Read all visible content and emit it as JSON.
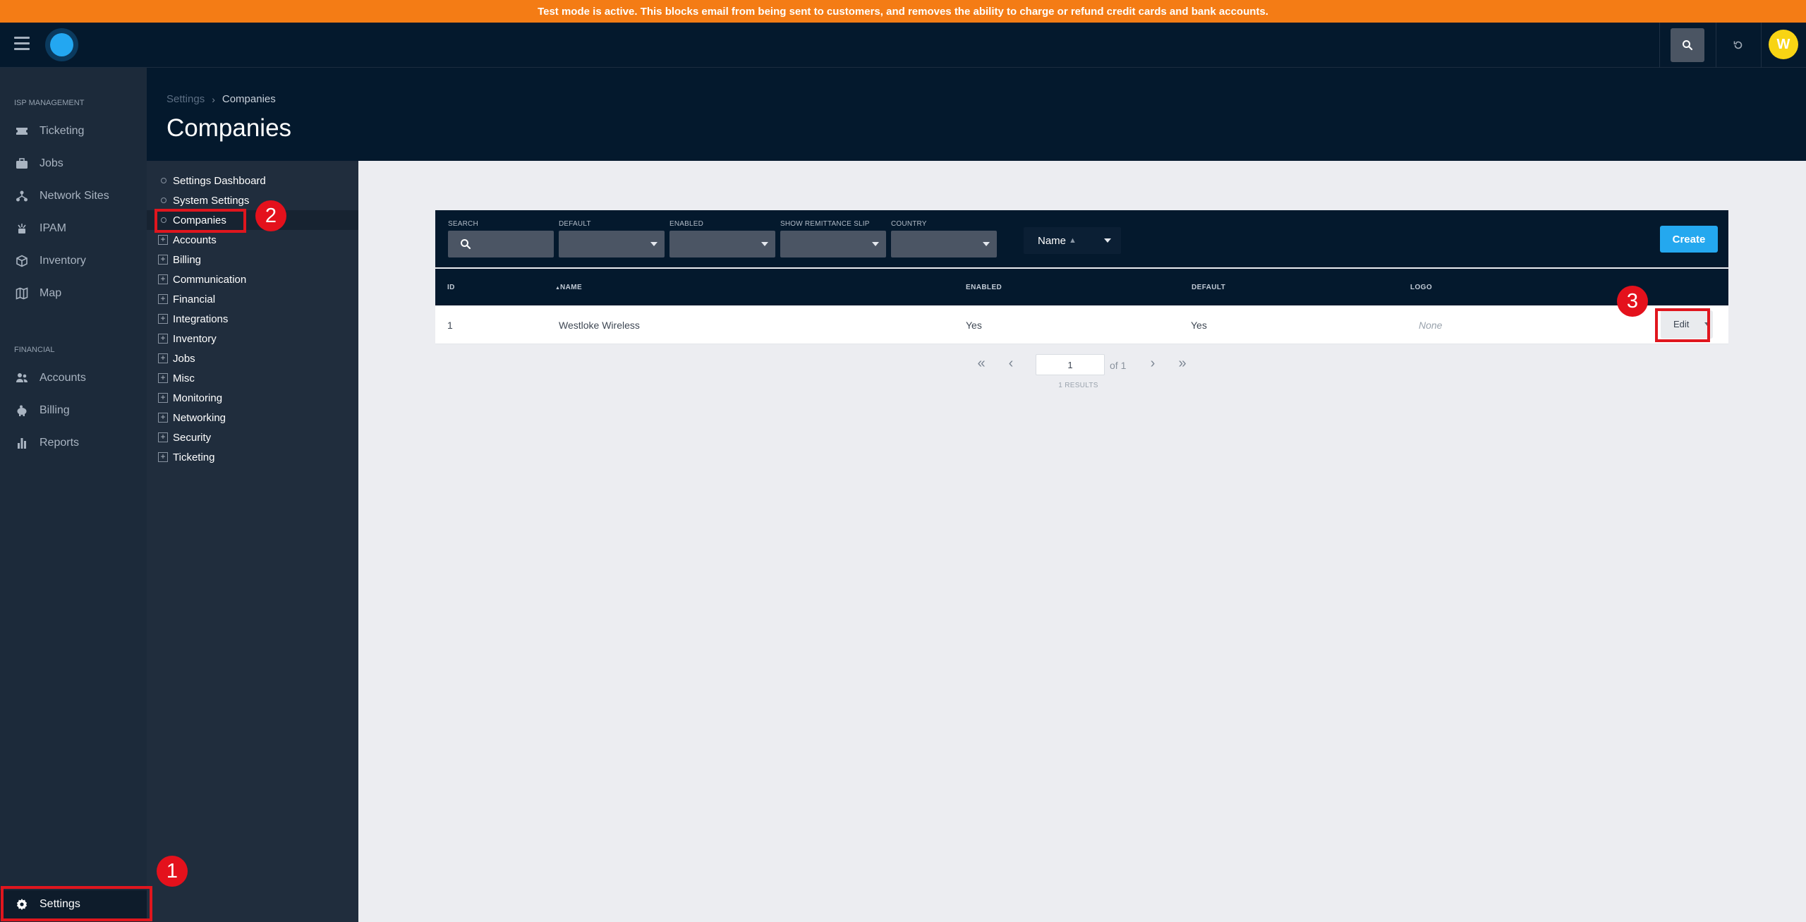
{
  "banner": {
    "text": "Test mode is active. This blocks email from being sent to customers, and removes the ability to charge or refund credit cards and bank accounts."
  },
  "topbar": {
    "menu_icon": "hamburger-icon",
    "search_icon": "search-icon",
    "refresh_icon": "refresh-icon",
    "avatar_initial": "W",
    "avatar_color": "#f8d414"
  },
  "sidebar": {
    "sections": [
      {
        "heading": "ISP MANAGEMENT",
        "items": [
          {
            "label": "Ticketing",
            "icon": "ticket-icon"
          },
          {
            "label": "Jobs",
            "icon": "briefcase-icon"
          },
          {
            "label": "Network Sites",
            "icon": "network-icon"
          },
          {
            "label": "IPAM",
            "icon": "ipam-icon"
          },
          {
            "label": "Inventory",
            "icon": "box-icon"
          },
          {
            "label": "Map",
            "icon": "map-icon"
          }
        ]
      },
      {
        "heading": "FINANCIAL",
        "items": [
          {
            "label": "Accounts",
            "icon": "users-icon"
          },
          {
            "label": "Billing",
            "icon": "piggy-bank-icon"
          },
          {
            "label": "Reports",
            "icon": "bar-chart-icon"
          }
        ]
      }
    ],
    "settings": {
      "label": "Settings",
      "icon": "gear-icon"
    }
  },
  "header": {
    "breadcrumb": {
      "parent": "Settings",
      "current": "Companies"
    },
    "title": "Companies"
  },
  "settings_tree": {
    "pages": [
      "Settings Dashboard",
      "System Settings",
      "Companies"
    ],
    "groups": [
      "Accounts",
      "Billing",
      "Communication",
      "Financial",
      "Integrations",
      "Inventory",
      "Jobs",
      "Misc",
      "Monitoring",
      "Networking",
      "Security",
      "Ticketing"
    ]
  },
  "filters": {
    "search_label": "SEARCH",
    "default_label": "DEFAULT",
    "enabled_label": "ENABLED",
    "remittance_label": "SHOW REMITTANCE SLIP",
    "country_label": "COUNTRY",
    "sort_value": "Name",
    "create_label": "Create"
  },
  "table": {
    "columns": {
      "id": "ID",
      "name": "NAME",
      "enabled": "ENABLED",
      "default": "DEFAULT",
      "logo": "LOGO"
    },
    "rows": [
      {
        "id": "1",
        "name": "Westloke Wireless",
        "enabled": "Yes",
        "default": "Yes",
        "logo": "None",
        "action": "Edit"
      }
    ]
  },
  "pagination": {
    "page": "1",
    "of_text": "of 1",
    "results": "1 RESULTS"
  },
  "annotations": [
    "1",
    "2",
    "3"
  ],
  "colors": {
    "banner": "#f47c15",
    "accent": "#24a8ef",
    "navy": "#04192d",
    "highlight": "#e0161e"
  }
}
